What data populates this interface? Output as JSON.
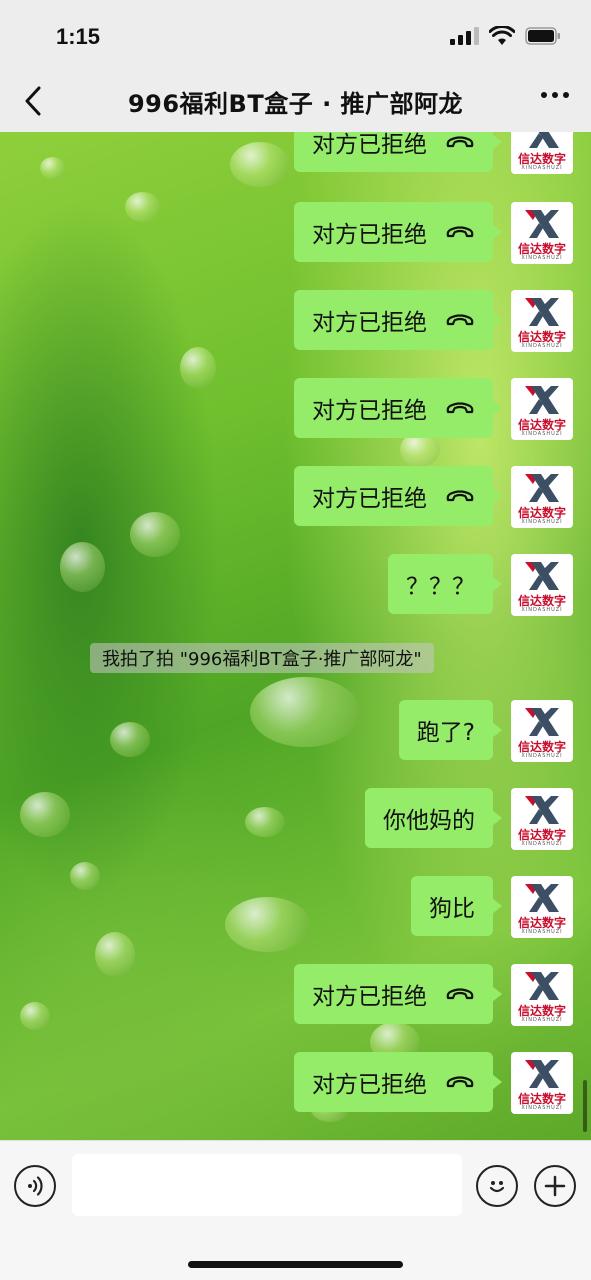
{
  "status_bar": {
    "time": "1:15"
  },
  "nav": {
    "title": "996福利BT盒子 · 推广部阿龙"
  },
  "messages": [
    {
      "text": "对方已拒绝",
      "type": "call"
    },
    {
      "text": "对方已拒绝",
      "type": "call"
    },
    {
      "text": "对方已拒绝",
      "type": "call"
    },
    {
      "text": "对方已拒绝",
      "type": "call"
    },
    {
      "text": "对方已拒绝",
      "type": "call"
    },
    {
      "text": "？？？",
      "type": "text"
    },
    {
      "text": "跑了?",
      "type": "text"
    },
    {
      "text": "你他妈的",
      "type": "text"
    },
    {
      "text": "狗比",
      "type": "text"
    },
    {
      "text": "对方已拒绝",
      "type": "call"
    },
    {
      "text": "对方已拒绝",
      "type": "call"
    }
  ],
  "system_message": "我拍了拍 \"996福利BT盒子·推广部阿龙\"",
  "avatar": {
    "brand_cn": "信达数字",
    "brand_en": "XINDASHUZI",
    "accent_color": "#c8102e"
  },
  "colors": {
    "bubble": "#95ec69"
  },
  "input": {
    "placeholder": ""
  },
  "icons": {
    "back": "chevron-left-icon",
    "more": "more-icon",
    "voice": "voice-icon",
    "emoji": "emoji-icon",
    "plus": "plus-icon",
    "hangup": "hangup-icon"
  }
}
